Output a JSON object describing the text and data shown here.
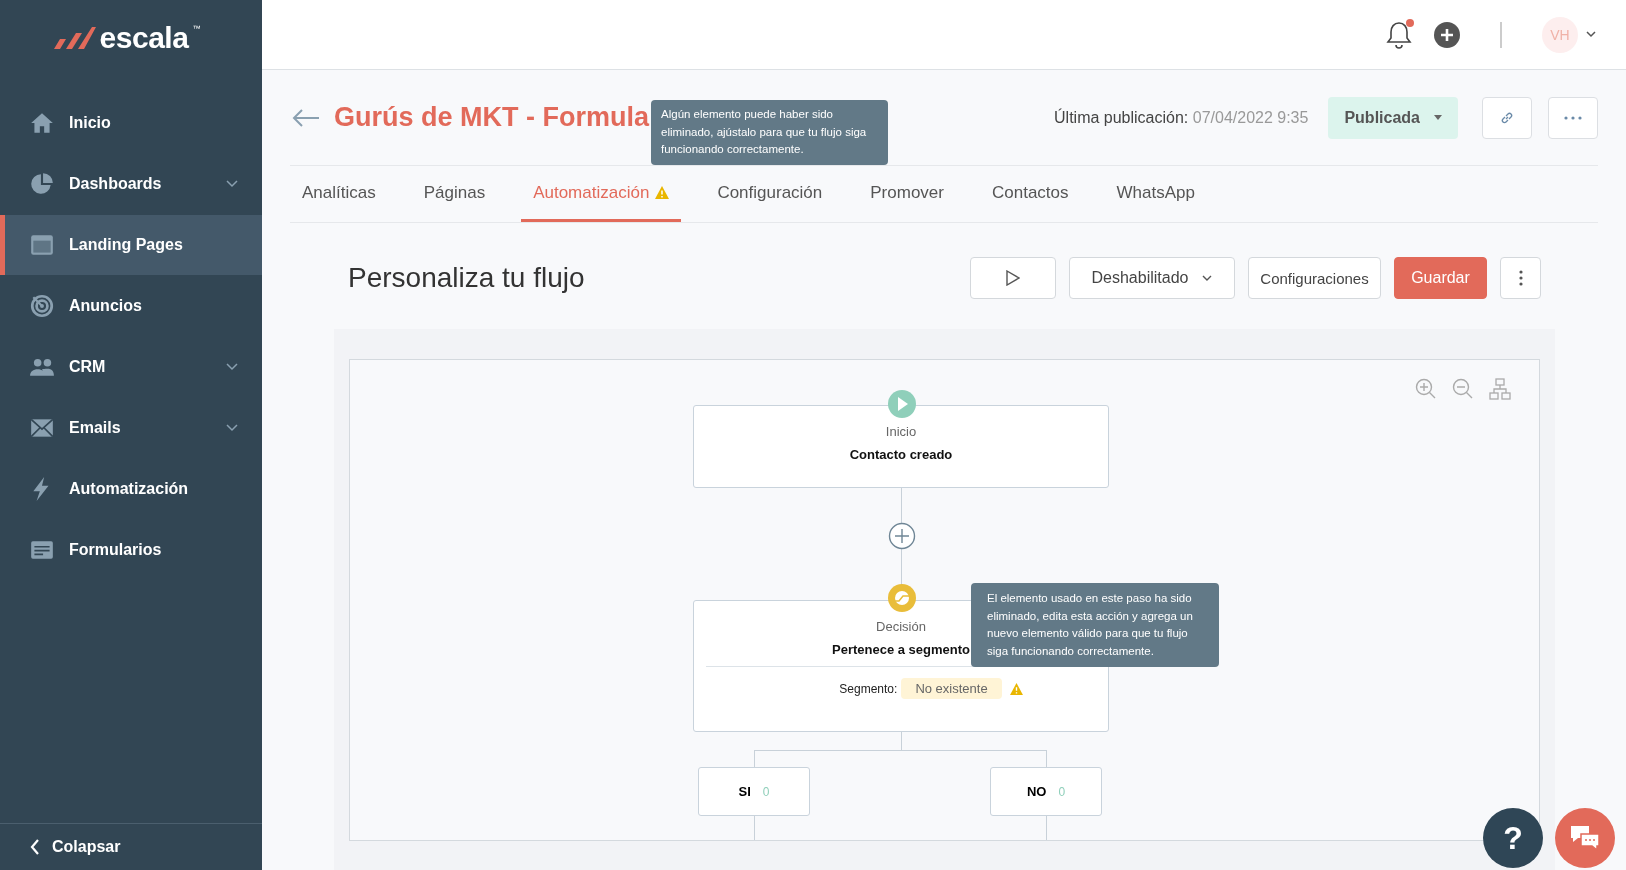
{
  "sidebar": {
    "logo": {
      "text": "escala",
      "mark": "™"
    },
    "items": [
      {
        "label": "Inicio",
        "expandable": false,
        "selected": false
      },
      {
        "label": "Dashboards",
        "expandable": true,
        "selected": false
      },
      {
        "label": "Landing Pages",
        "expandable": false,
        "selected": true
      },
      {
        "label": "Anuncios",
        "expandable": false,
        "selected": false
      },
      {
        "label": "CRM",
        "expandable": true,
        "selected": false
      },
      {
        "label": "Emails",
        "expandable": true,
        "selected": false
      },
      {
        "label": "Automatización",
        "expandable": false,
        "selected": false
      },
      {
        "label": "Formularios",
        "expandable": false,
        "selected": false
      }
    ],
    "collapse": "Colapsar"
  },
  "topbar": {
    "notifications_unread": true,
    "avatar": "VH"
  },
  "header": {
    "title": "Gurús de MKT - Formula",
    "last_published_label": "Última publicación:",
    "last_published": "07/04/2022 9:35",
    "status": "Publicada"
  },
  "tabs": [
    {
      "label": "Analíticas",
      "selected": false,
      "warning": false
    },
    {
      "label": "Páginas",
      "selected": false,
      "warning": false
    },
    {
      "label": "Automatización",
      "selected": true,
      "warning": true
    },
    {
      "label": "Configuración",
      "selected": false,
      "warning": false
    },
    {
      "label": "Promover",
      "selected": false,
      "warning": false
    },
    {
      "label": "Contactos",
      "selected": false,
      "warning": false
    },
    {
      "label": "WhatsApp",
      "selected": false,
      "warning": false
    }
  ],
  "tab_tooltip": "Algún elemento puede haber sido eliminado, ajústalo para que tu flujo siga funcionando correctamente.",
  "flow": {
    "title": "Personaliza tu flujo",
    "state": "Deshabilitado",
    "settings": "Configuraciones",
    "save": "Guardar",
    "start": {
      "type": "Inicio",
      "name": "Contacto creado"
    },
    "decision": {
      "type": "Decisión",
      "name": "Pertenece a segmento",
      "field_label": "Segmento:",
      "field_value": "No existente",
      "warning": true,
      "tooltip": "El elemento usado en este paso ha sido eliminado, edita esta acción y agrega un nuevo elemento válido para que tu flujo siga funcionando correctamente."
    },
    "branches": [
      {
        "label": "SI",
        "count": "0"
      },
      {
        "label": "NO",
        "count": "0"
      }
    ]
  },
  "help": "?"
}
